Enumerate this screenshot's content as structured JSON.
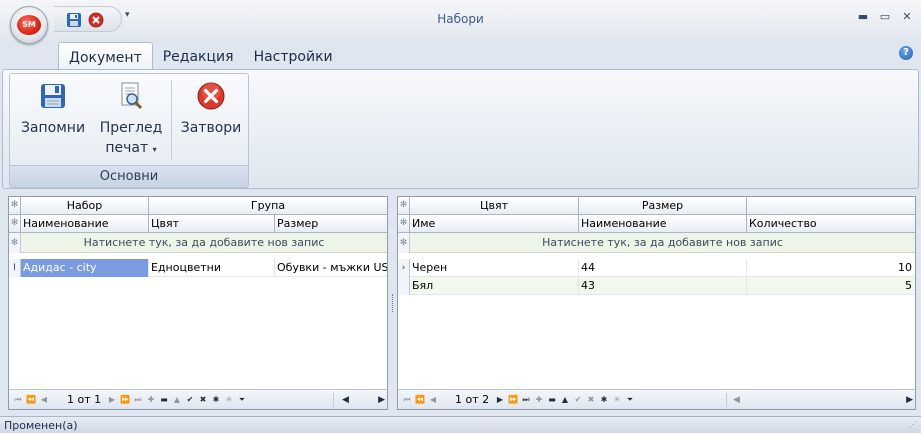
{
  "app": {
    "logo_text": "SM",
    "title": "Набори"
  },
  "window_controls": {
    "minimize": "▬",
    "maximize": "▭",
    "close": "✕"
  },
  "tabs": [
    {
      "label": "Документ",
      "active": true
    },
    {
      "label": "Редакция",
      "active": false
    },
    {
      "label": "Настройки",
      "active": false
    }
  ],
  "help": {
    "glyph": "?"
  },
  "ribbon": {
    "group_caption": "Основни",
    "save_label": "Запомни",
    "preview_line1": "Преглед",
    "preview_line2": "печат",
    "close_label": "Затвори"
  },
  "left_grid": {
    "band_headers": [
      "Набор",
      "Група"
    ],
    "columns": [
      "Наименование",
      "Цвят",
      "Размер"
    ],
    "new_row_text": "Натиснете тук, за да добавите нов запис",
    "rows": [
      {
        "indicator": "I",
        "name": "Адидас - city",
        "color": "Едноцветни",
        "size": "Обувки - мъжки USA"
      }
    ],
    "counter": "1 от 1"
  },
  "right_grid": {
    "band_headers": [
      "Цвят",
      "Размер",
      ""
    ],
    "columns": [
      "Име",
      "Наименование",
      "Количество"
    ],
    "new_row_text": "Натиснете тук, за да добавите нов запис",
    "rows": [
      {
        "indicator": "›",
        "name": "Черен",
        "size": "44",
        "qty": "10"
      },
      {
        "indicator": "",
        "name": "Бял",
        "size": "43",
        "qty": "5"
      }
    ],
    "counter": "1 от 2"
  },
  "status": {
    "text": "Променен(а)"
  },
  "colors": {
    "selection": "#7b9be0",
    "new_row_bg": "#edf5e8",
    "title_text": "#3d5d88"
  }
}
